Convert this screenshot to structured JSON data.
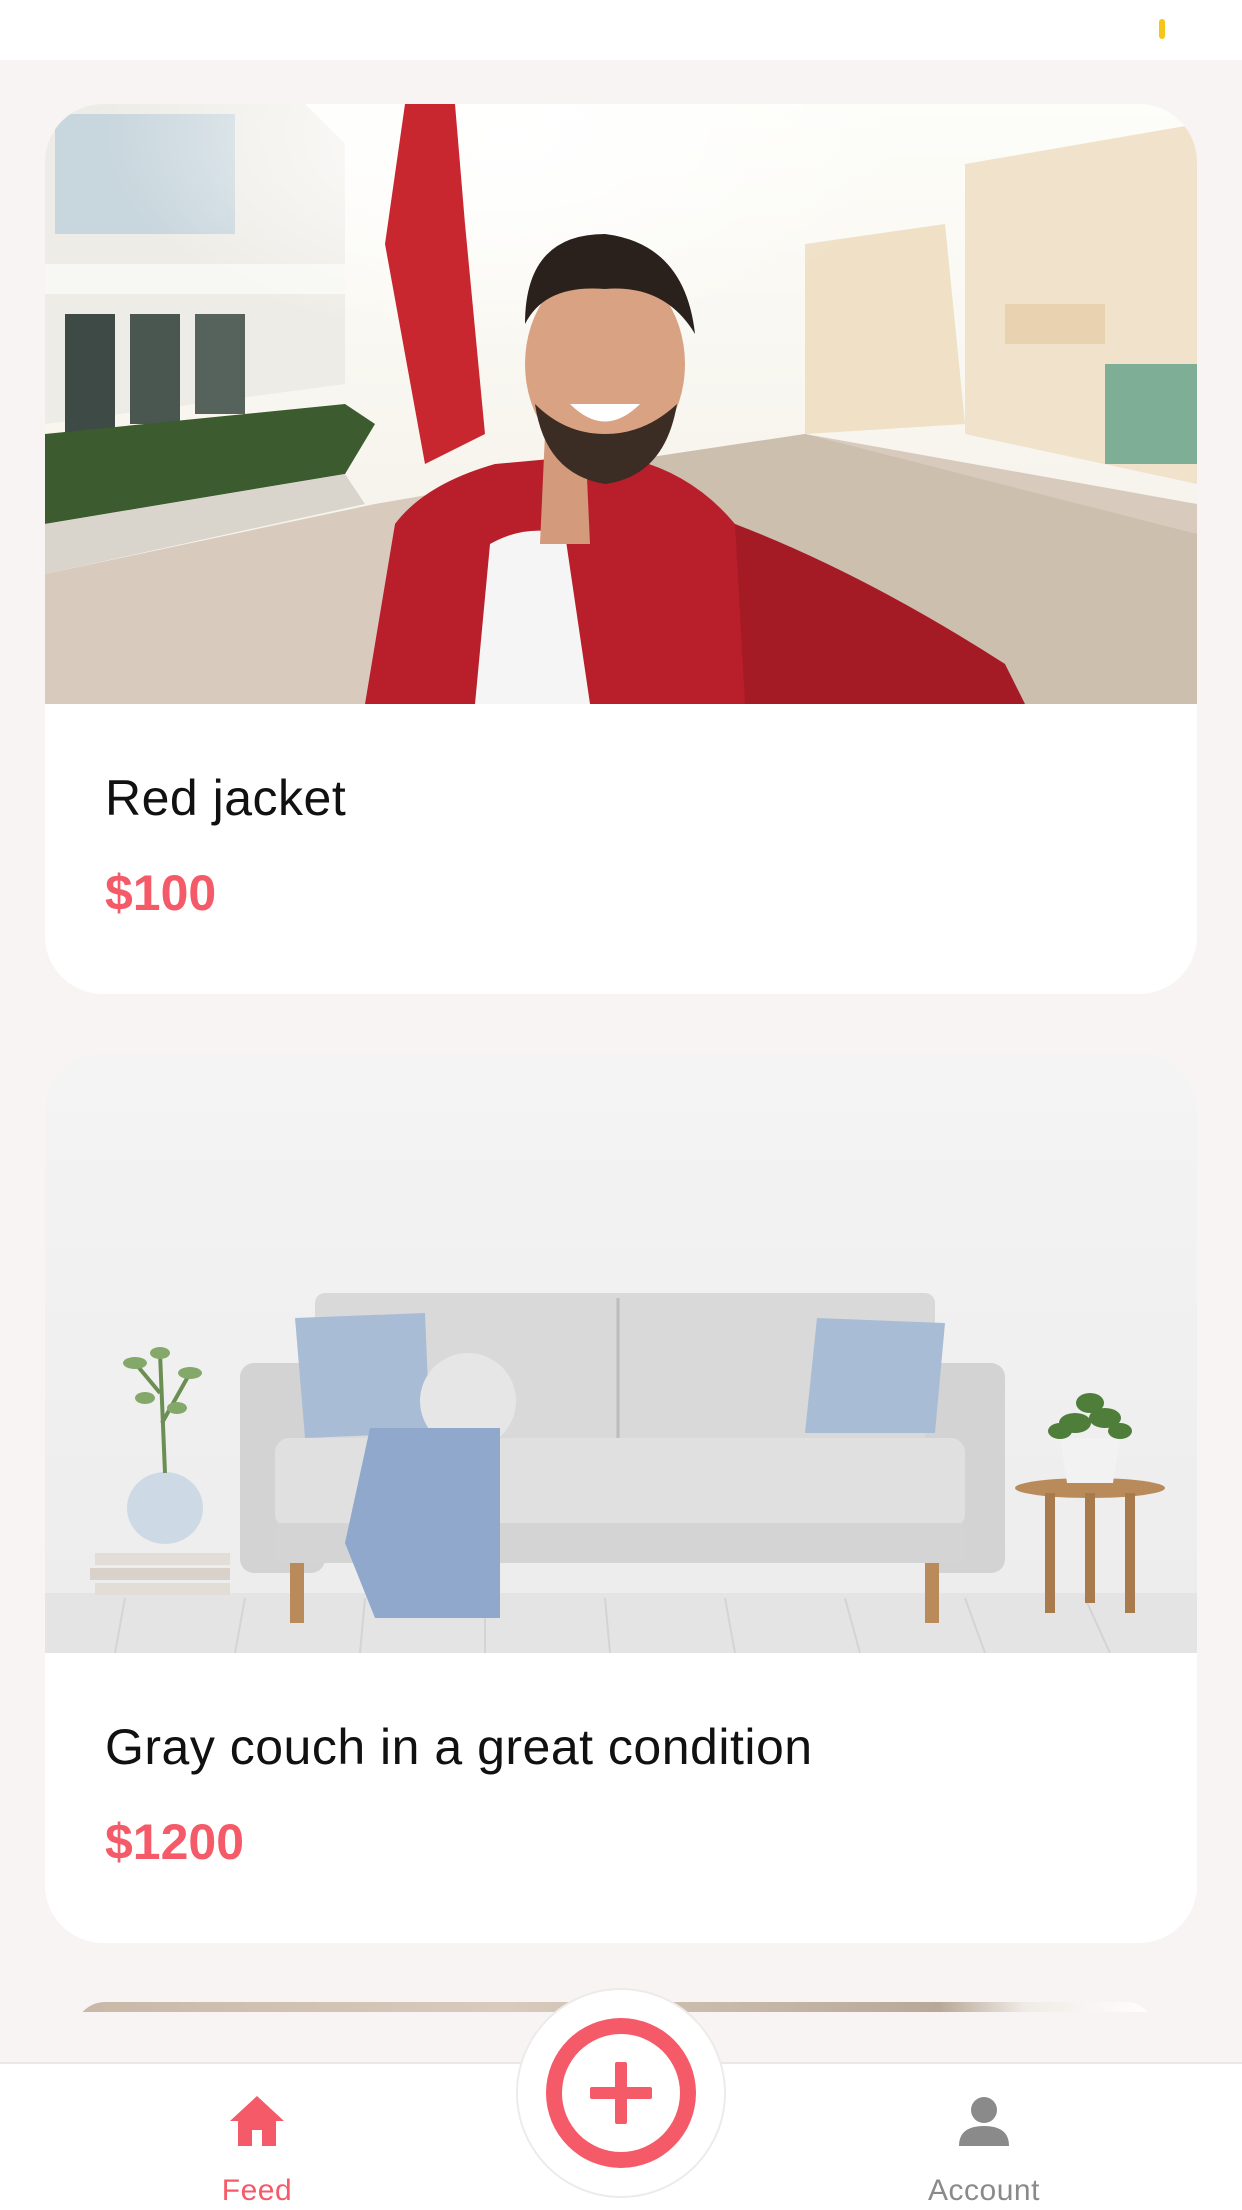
{
  "colors": {
    "accent": "#f55a69",
    "inactive": "#8a8a8a",
    "battery": "#f5c518"
  },
  "status_bar": {
    "battery_icon": "battery-icon"
  },
  "feed": {
    "items": [
      {
        "title": "Red jacket",
        "price": "$100",
        "image": "photo of smiling man in red jacket taking a selfie on a street"
      },
      {
        "title": "Gray couch in a great condition",
        "price": "$1200",
        "image": "photo of a gray couch with blue pillows in a white room"
      }
    ]
  },
  "tab_bar": {
    "tabs": [
      {
        "label": "Feed",
        "icon": "home-icon",
        "active": true
      },
      {
        "label": "Account",
        "icon": "person-icon",
        "active": false
      }
    ],
    "add_button_icon": "plus-icon"
  }
}
